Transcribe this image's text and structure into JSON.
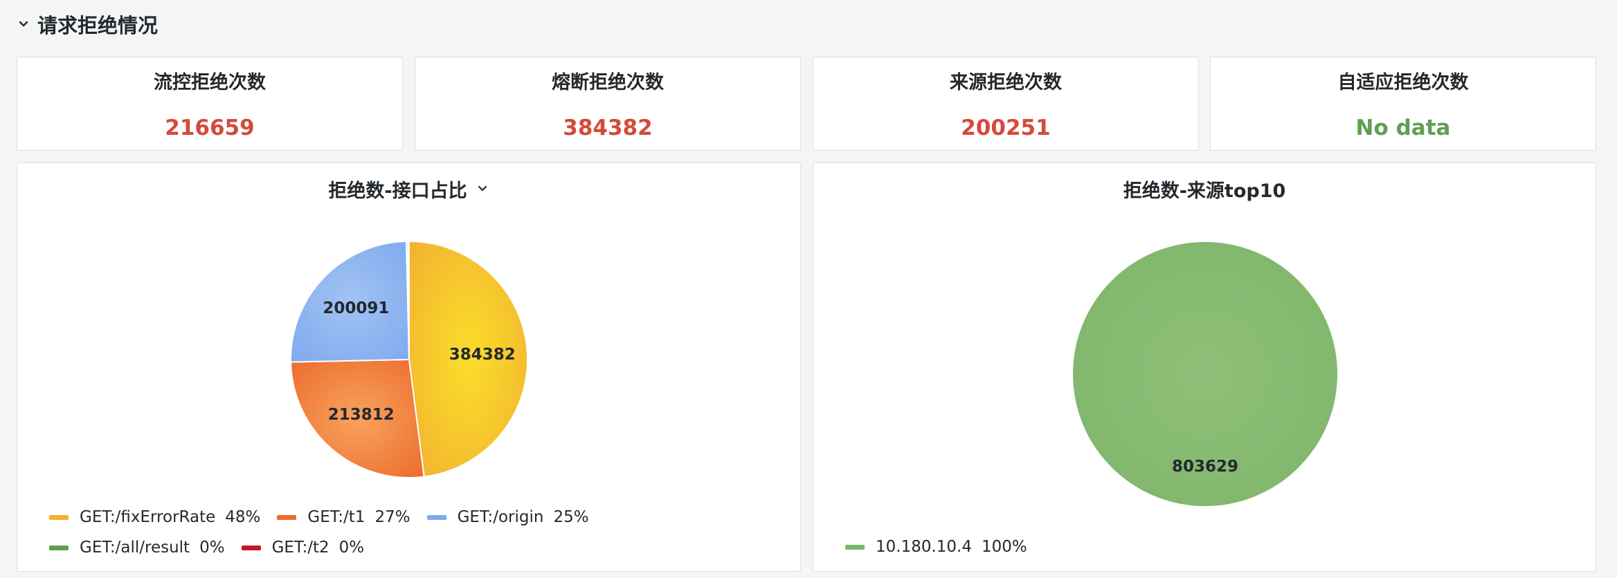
{
  "row": {
    "title": "请求拒绝情况"
  },
  "stats": [
    {
      "title": "流控拒绝次数",
      "value": "216659",
      "color": "#d44a3a"
    },
    {
      "title": "熔断拒绝次数",
      "value": "384382",
      "color": "#d44a3a"
    },
    {
      "title": "来源拒绝次数",
      "value": "200251",
      "color": "#d44a3a"
    },
    {
      "title": "自适应拒绝次数",
      "value": "No data",
      "color": "#629e51"
    }
  ],
  "pie_interface": {
    "title": "拒绝数-接口占比",
    "slices": [
      {
        "label": "GET:/fixErrorRate",
        "value": 384382,
        "percent": "48%",
        "value_label": "384382",
        "color": "#fade2a",
        "color2": "#f2b131"
      },
      {
        "label": "GET:/t1",
        "value": 213812,
        "percent": "27%",
        "value_label": "213812",
        "color": "#f8a35e",
        "color2": "#ed6b2c"
      },
      {
        "label": "GET:/origin",
        "value": 200091,
        "percent": "25%",
        "value_label": "200091",
        "color": "#a2c3f2",
        "color2": "#7fa9ef"
      },
      {
        "label": "GET:/all/result",
        "value": 1740,
        "percent": "0%",
        "value_label": "",
        "color": "#7eb26d",
        "color2": "#629e51"
      },
      {
        "label": "GET:/t2",
        "value": 1200,
        "percent": "0%",
        "value_label": "",
        "color": "#e24d42",
        "color2": "#c4162a"
      }
    ]
  },
  "pie_source": {
    "title": "拒绝数-来源top10",
    "slices": [
      {
        "label": "10.180.10.4",
        "value": 803629,
        "percent": "100%",
        "value_label": "803629",
        "color": "#8fbf78",
        "color2": "#7db56a"
      }
    ]
  },
  "chart_data": [
    {
      "type": "pie",
      "title": "拒绝数-接口占比",
      "labels": [
        "GET:/fixErrorRate",
        "GET:/t1",
        "GET:/origin",
        "GET:/all/result",
        "GET:/t2"
      ],
      "values": [
        384382,
        213812,
        200091,
        1740,
        1200
      ],
      "percents": [
        "48%",
        "27%",
        "25%",
        "0%",
        "0%"
      ],
      "legend": "bottom"
    },
    {
      "type": "pie",
      "title": "拒绝数-来源top10",
      "labels": [
        "10.180.10.4"
      ],
      "values": [
        803629
      ],
      "percents": [
        "100%"
      ],
      "legend": "bottom"
    }
  ]
}
